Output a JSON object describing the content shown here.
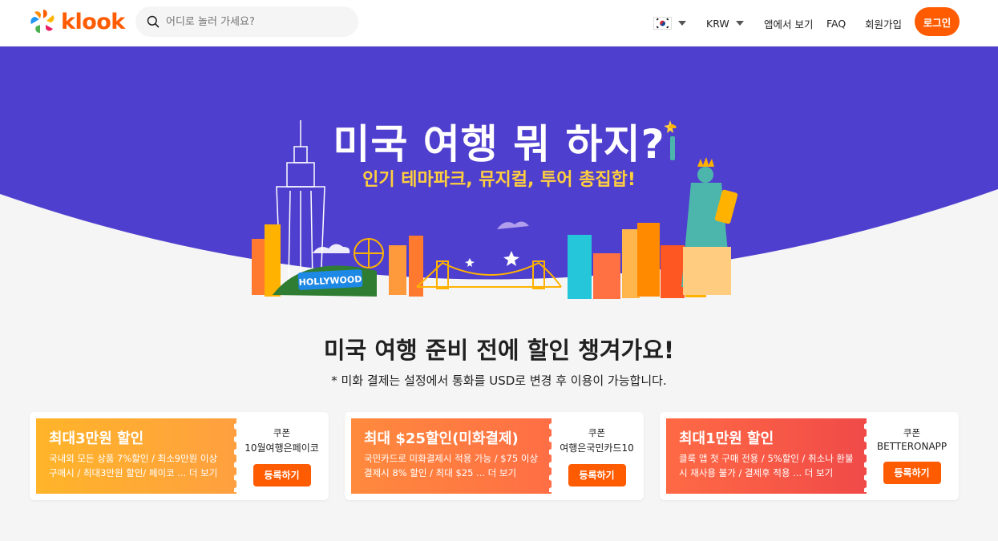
{
  "header": {
    "logo_text": "klook",
    "search": {
      "placeholder": "어디로 놀러 가세요?"
    },
    "currency": "KRW",
    "app_link": "앱에서 보기",
    "faq_link": "FAQ",
    "signup_link": "회원가입",
    "login_button": "로그인",
    "icons": {
      "search": "search-icon",
      "flag": "korea-flag-icon",
      "dropdown": "chevron-down-icon"
    }
  },
  "banner": {
    "title": "미국 여행 뭐 하지?",
    "subtitle": "인기 테마파크, 뮤지컬, 투어 총집합!",
    "sign_text": "HOLLYWOOD",
    "colors": {
      "sky": "#4f3fce",
      "accent": "#ffcf3d"
    }
  },
  "section": {
    "title": "미국 여행 준비 전에 할인 챙겨가요!",
    "note": "* 미화 결제는 설정에서 통화를 USD로 변경 후 이용이 가능합니다."
  },
  "coupons": [
    {
      "title": "최대3만원 할인",
      "desc": "국내외 모든 상품 7%할인 / 최소9만원 이상 구매시 / 최대3만원 할인/ 페이코 ... 더 보기",
      "label": "쿠폰",
      "code": "10월여행은페이코",
      "button": "등록하기"
    },
    {
      "title": "최대 $25할인(미화결제)",
      "desc": "국민카드로 미화결제시 적용 가능 / $75 이상 결제시 8% 할인 / 최대 $25 ... 더 보기",
      "label": "쿠폰",
      "code": "여행은국민카드10",
      "button": "등록하기"
    },
    {
      "title": "최대1만원 할인",
      "desc": "클룩 앱 첫 구매 전용 / 5%할인 / 취소나 환불시 재사용 불가 / 결제후 적용 ... 더 보기",
      "label": "쿠폰",
      "code": "BETTERONAPP",
      "button": "등록하기"
    }
  ],
  "colors": {
    "brand": "#ff5b00",
    "text": "#212121",
    "background": "#f5f5f5"
  }
}
